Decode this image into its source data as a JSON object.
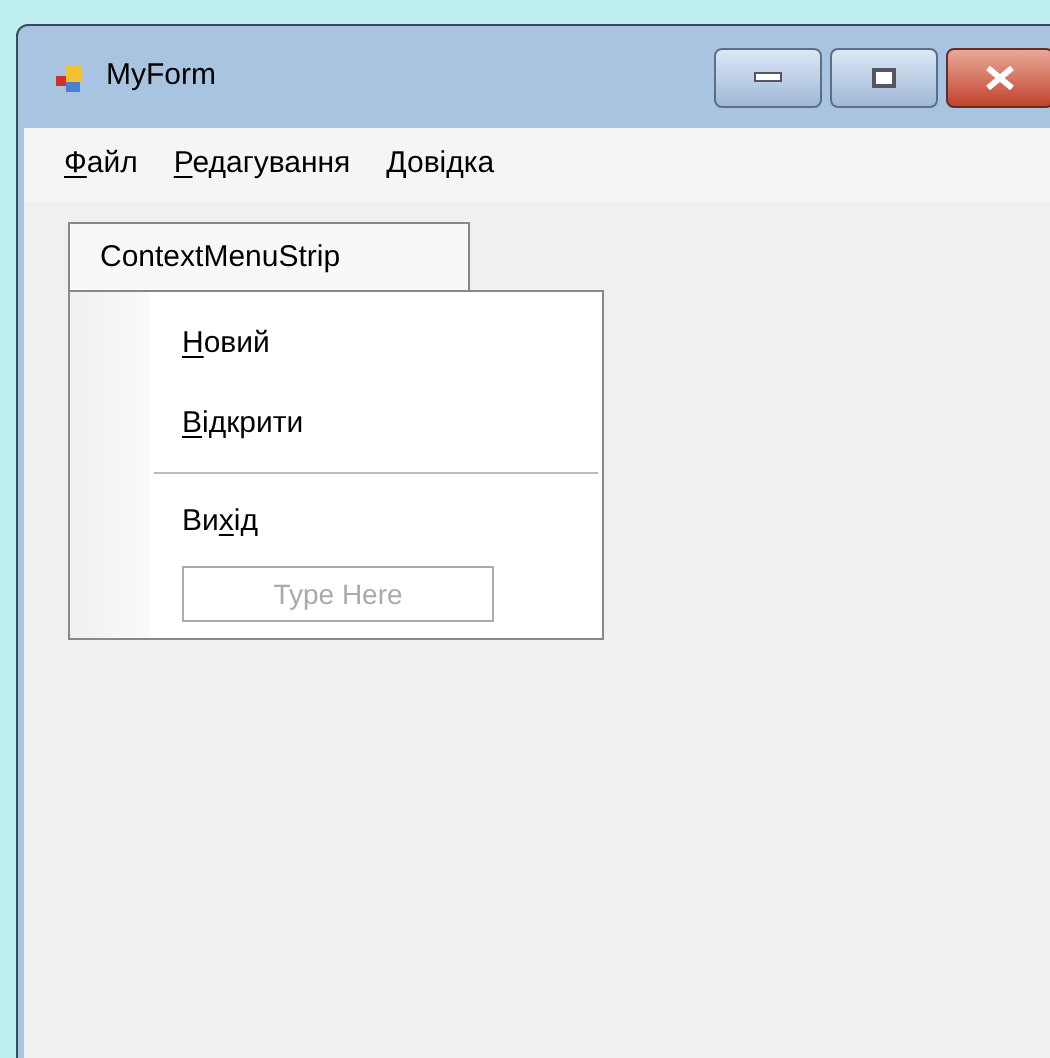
{
  "window": {
    "title": "MyForm"
  },
  "menu_bar": [
    {
      "key": "Ф",
      "after": "айл"
    },
    {
      "key": "Р",
      "after": "едагування"
    },
    {
      "key": "Д",
      "after": "овідка"
    }
  ],
  "context_menu": {
    "title": "ContextMenuStrip",
    "items": [
      {
        "kind": "item",
        "key": "Н",
        "after": "овий"
      },
      {
        "kind": "item",
        "key": "В",
        "after": "ідкрити"
      },
      {
        "kind": "separator"
      },
      {
        "kind": "item",
        "before": "Ви",
        "key": "х",
        "after": "ід"
      },
      {
        "kind": "input",
        "placeholder": "Type Here"
      }
    ]
  }
}
